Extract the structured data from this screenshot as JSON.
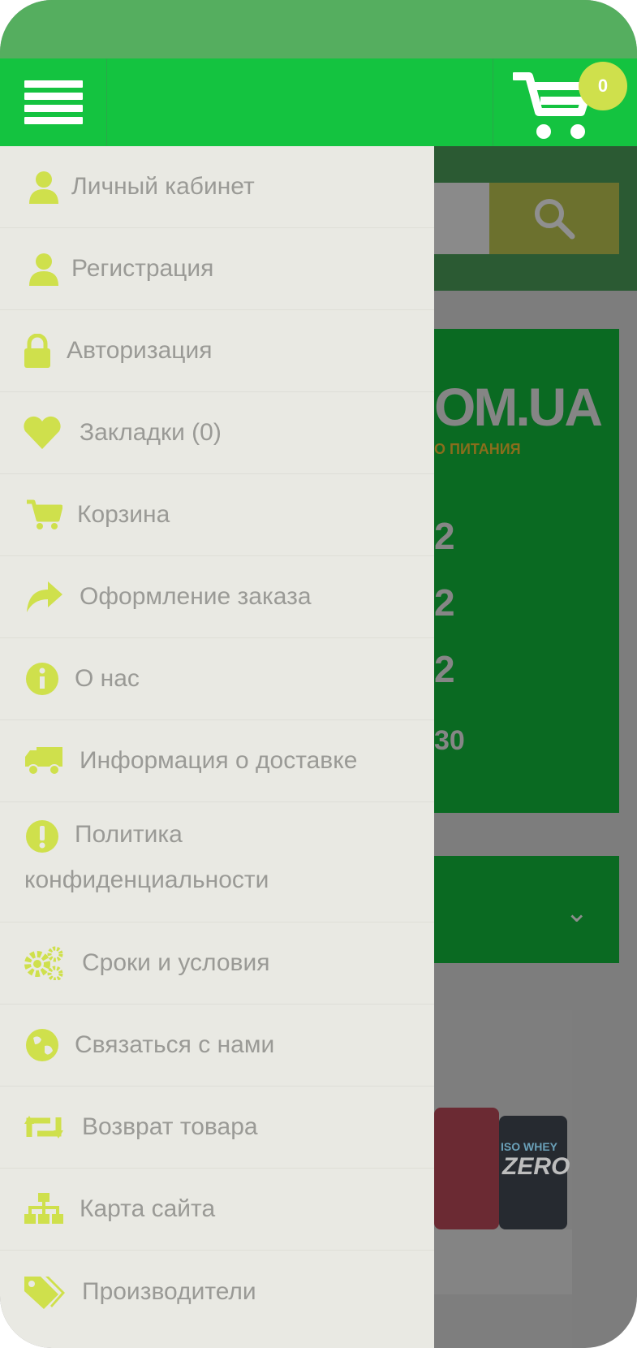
{
  "header": {
    "cart_count": "0"
  },
  "background": {
    "brand_fragment": "OM.UA",
    "brand_sub": "О ПИТАНИЯ",
    "digits": [
      "2",
      "2",
      "2"
    ],
    "bottom_fragment": "30",
    "product_label_1": "ISO WHEY",
    "product_label_2": "ZERO"
  },
  "menu": {
    "items": [
      {
        "label": "Личный кабинет",
        "icon": "user-icon"
      },
      {
        "label": "Регистрация",
        "icon": "user-icon"
      },
      {
        "label": "Авторизация",
        "icon": "lock-icon"
      },
      {
        "label": "Закладки (0)",
        "icon": "heart-icon"
      },
      {
        "label": "Корзина",
        "icon": "cart-icon"
      },
      {
        "label": "Оформление заказа",
        "icon": "share-arrow-icon"
      },
      {
        "label": "О нас",
        "icon": "info-icon"
      },
      {
        "label": "Информация о доставке",
        "icon": "truck-icon"
      },
      {
        "label": "Политика",
        "label2": "конфиденциальности",
        "icon": "exclamation-icon"
      },
      {
        "label": "Сроки и условия",
        "icon": "gears-icon"
      },
      {
        "label": "Связаться с нами",
        "icon": "globe-icon"
      },
      {
        "label": "Возврат товара",
        "icon": "retweet-icon"
      },
      {
        "label": "Карта сайта",
        "icon": "sitemap-icon"
      },
      {
        "label": "Производители",
        "icon": "tags-icon"
      }
    ]
  },
  "colors": {
    "header_green": "#14c340",
    "accent_lime": "#cfe04c",
    "drawer_bg": "#e9e9e3",
    "menu_text": "#9a9a96"
  }
}
